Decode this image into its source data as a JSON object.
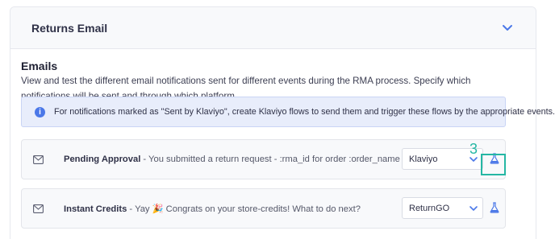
{
  "section": {
    "title": "Returns Email"
  },
  "emails": {
    "title": "Emails",
    "description": "View and test the different email notifications sent for different events during the RMA process. Specify which notifications will be sent and through which platform."
  },
  "info": {
    "text": "For notifications marked as \"Sent by Klaviyo\", create Klaviyo flows to send them and trigger these flows by the appropriate events."
  },
  "rows": [
    {
      "name": "Pending Approval",
      "subject": " - You submitted a return request - :rma_id for order :order_name",
      "platform": "Klaviyo"
    },
    {
      "name": "Instant Credits",
      "subject": " - Yay 🎉 Congrats on your store-credits! What to do next?",
      "platform": "ReturnGO"
    }
  ],
  "annotation": {
    "step": "3"
  },
  "colors": {
    "accent": "#4b78e8",
    "highlight": "#25b7a4"
  },
  "icons": [
    "chevron-down-icon",
    "info-icon",
    "mail-icon",
    "flask-icon"
  ]
}
